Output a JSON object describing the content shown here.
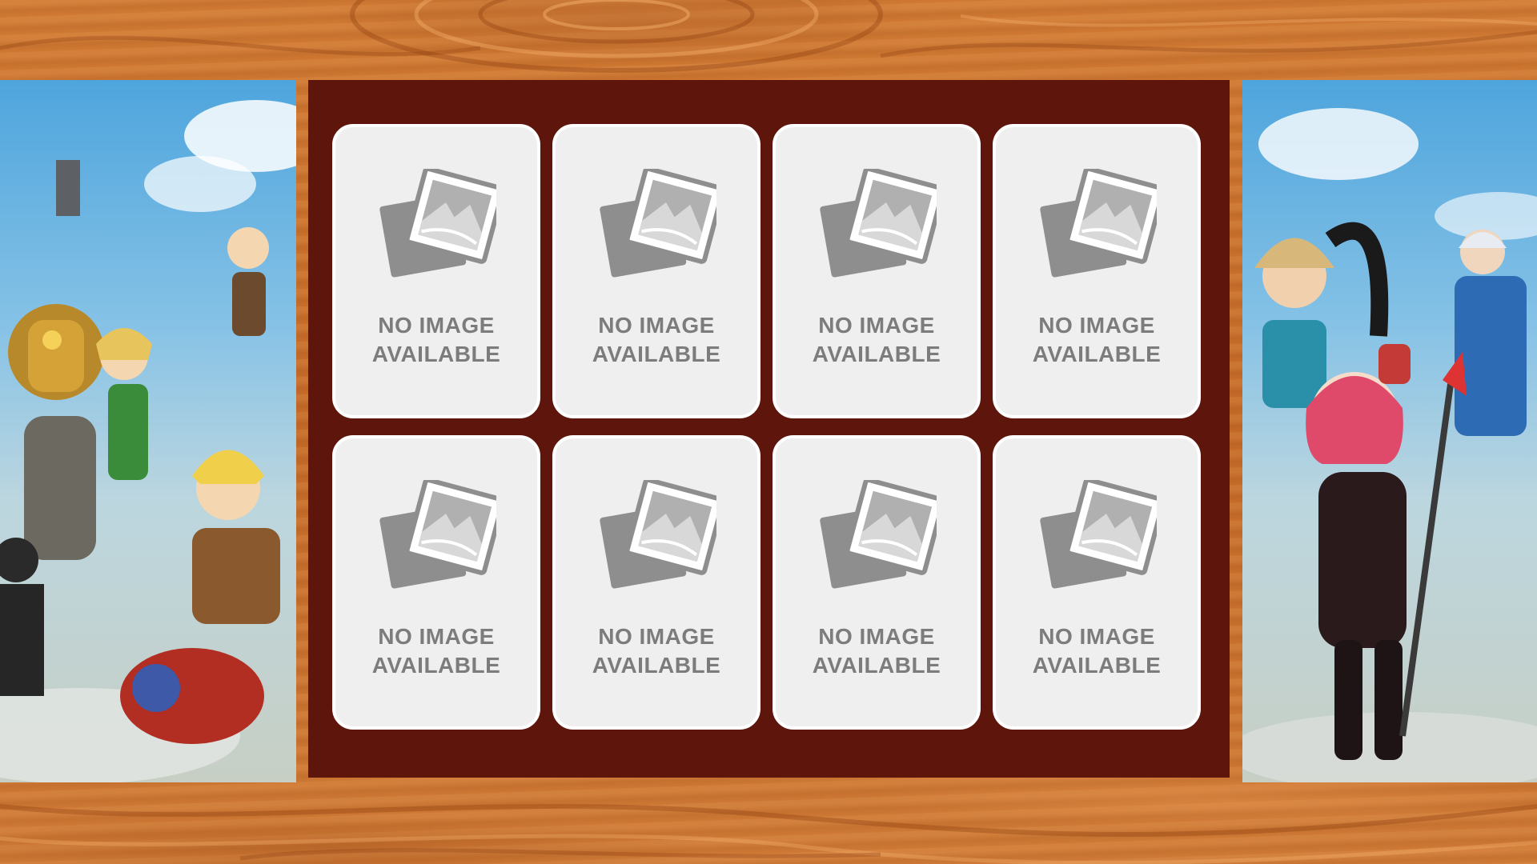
{
  "colors": {
    "wood": "#c86f2e",
    "panel": "#5e150b",
    "card": "#efefef",
    "card_border": "#ffffff",
    "placeholder_text": "#7c7c7c"
  },
  "side_art": {
    "left": "game-characters-artwork-left",
    "right": "game-characters-artwork-right"
  },
  "cards": [
    {
      "icon": "image-placeholder-icon",
      "text": "NO IMAGE\nAVAILABLE"
    },
    {
      "icon": "image-placeholder-icon",
      "text": "NO IMAGE\nAVAILABLE"
    },
    {
      "icon": "image-placeholder-icon",
      "text": "NO IMAGE\nAVAILABLE"
    },
    {
      "icon": "image-placeholder-icon",
      "text": "NO IMAGE\nAVAILABLE"
    },
    {
      "icon": "image-placeholder-icon",
      "text": "NO IMAGE\nAVAILABLE"
    },
    {
      "icon": "image-placeholder-icon",
      "text": "NO IMAGE\nAVAILABLE"
    },
    {
      "icon": "image-placeholder-icon",
      "text": "NO IMAGE\nAVAILABLE"
    },
    {
      "icon": "image-placeholder-icon",
      "text": "NO IMAGE\nAVAILABLE"
    }
  ]
}
